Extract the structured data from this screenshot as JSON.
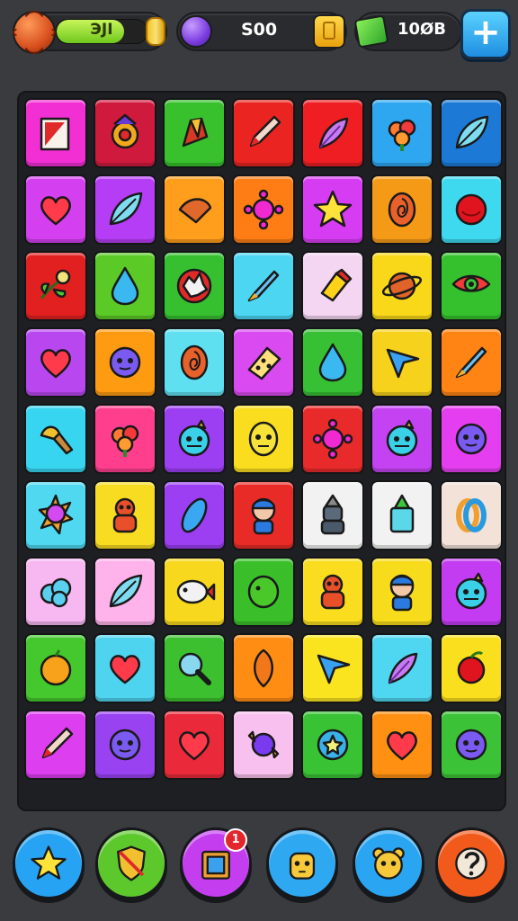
{
  "hud": {
    "level_text": "ЭJI",
    "level_progress": 0.75,
    "gems_text": "S00",
    "cash_text": "10ØB",
    "add_label": "+"
  },
  "board": {
    "rows": [
      [
        {
          "color": "#f22fd3",
          "icon": "book-icon"
        },
        {
          "color": "#cf1a3d",
          "icon": "totem-icon"
        },
        {
          "color": "#38c12c",
          "icon": "crystal-icon"
        },
        {
          "color": "#ea2420",
          "icon": "pencil-icon"
        },
        {
          "color": "#ee1e22",
          "icon": "feather-icon"
        },
        {
          "color": "#2ea6f0",
          "icon": "flower-icon"
        },
        {
          "color": "#1c7ad6",
          "icon": "leaf-icon"
        }
      ],
      [
        {
          "color": "#d43ff0",
          "icon": "heart-icon"
        },
        {
          "color": "#b53df5",
          "icon": "leaf-icon"
        },
        {
          "color": "#ff9d1c",
          "icon": "cone-icon"
        },
        {
          "color": "#ff7d14",
          "icon": "virus-icon"
        },
        {
          "color": "#d63cf2",
          "icon": "star-icon"
        },
        {
          "color": "#f59a16",
          "icon": "swirl-icon"
        },
        {
          "color": "#3ed8ef",
          "icon": "ball-icon"
        }
      ],
      [
        {
          "color": "#e22020",
          "icon": "branch-icon"
        },
        {
          "color": "#5bc926",
          "icon": "drop-icon"
        },
        {
          "color": "#36c030",
          "icon": "burst-icon"
        },
        {
          "color": "#4cd6f2",
          "icon": "rocket-icon"
        },
        {
          "color": "#f4d6f2",
          "icon": "marker-icon"
        },
        {
          "color": "#f9d81a",
          "icon": "planet-icon"
        },
        {
          "color": "#35c12d",
          "icon": "eye-icon"
        }
      ],
      [
        {
          "color": "#b847f0",
          "icon": "heart-icon"
        },
        {
          "color": "#ff9b10",
          "icon": "orb-icon"
        },
        {
          "color": "#5fe0f0",
          "icon": "swirl-icon"
        },
        {
          "color": "#d94bf0",
          "icon": "dice-icon"
        },
        {
          "color": "#38c034",
          "icon": "drop-icon"
        },
        {
          "color": "#f7d21c",
          "icon": "arrow-icon"
        },
        {
          "color": "#ff8413",
          "icon": "rocket-icon"
        }
      ],
      [
        {
          "color": "#38d5f0",
          "icon": "brush-icon"
        },
        {
          "color": "#ff3f8e",
          "icon": "flower-icon"
        },
        {
          "color": "#9c3ef2",
          "icon": "monster-icon"
        },
        {
          "color": "#f9dd1e",
          "icon": "face-icon"
        },
        {
          "color": "#e92a2a",
          "icon": "virus-icon"
        },
        {
          "color": "#c442f2",
          "icon": "monster-icon"
        },
        {
          "color": "#e53ef0",
          "icon": "orb-icon"
        }
      ],
      [
        {
          "color": "#4fd8f0",
          "icon": "sun-icon"
        },
        {
          "color": "#f8dc22",
          "icon": "robot-icon"
        },
        {
          "color": "#9c3ef2",
          "icon": "capsule-icon"
        },
        {
          "color": "#e92b28",
          "icon": "character-icon"
        },
        {
          "color": "#f2f2f2",
          "icon": "knight-icon"
        },
        {
          "color": "#f2f2f2",
          "icon": "potion-icon"
        },
        {
          "color": "#f2e2d8",
          "icon": "knot-icon"
        }
      ],
      [
        {
          "color": "#f7b8f2",
          "icon": "cloud-icon"
        },
        {
          "color": "#ffb3ea",
          "icon": "leaf-icon"
        },
        {
          "color": "#f7d81e",
          "icon": "fish-icon"
        },
        {
          "color": "#3abf2a",
          "icon": "blob-icon"
        },
        {
          "color": "#f9dd1e",
          "icon": "robot-icon"
        },
        {
          "color": "#f7dc1c",
          "icon": "character-icon"
        },
        {
          "color": "#c43cf2",
          "icon": "monster-icon"
        }
      ],
      [
        {
          "color": "#44c82e",
          "icon": "fruit-icon"
        },
        {
          "color": "#4fd4f0",
          "icon": "heart-icon"
        },
        {
          "color": "#3cc030",
          "icon": "magnifier-icon"
        },
        {
          "color": "#ff8d14",
          "icon": "seed-icon"
        },
        {
          "color": "#f9e41f",
          "icon": "arrow-icon"
        },
        {
          "color": "#4fd6f0",
          "icon": "feather-icon"
        },
        {
          "color": "#f9df1e",
          "icon": "apple-icon"
        }
      ],
      [
        {
          "color": "#dc3ef0",
          "icon": "pencil-icon"
        },
        {
          "color": "#9942f2",
          "icon": "orb-icon"
        },
        {
          "color": "#ea2a3a",
          "icon": "heart-icon"
        },
        {
          "color": "#f8c0ee",
          "icon": "candy-icon"
        },
        {
          "color": "#38c234",
          "icon": "star-orb-icon"
        },
        {
          "color": "#ff9012",
          "icon": "heart-icon"
        },
        {
          "color": "#3bc236",
          "icon": "orb-icon"
        }
      ]
    ]
  },
  "bottom_bar": {
    "buttons": [
      {
        "name": "star-button",
        "icon": "star-icon",
        "color": "#26a3f2"
      },
      {
        "name": "shield-button",
        "icon": "shield-icon",
        "color": "#5cc82c"
      },
      {
        "name": "inventory-button",
        "icon": "inventory-icon",
        "color": "#c43ef0",
        "badge": "1"
      },
      {
        "name": "pet-button",
        "icon": "pet-icon",
        "color": "#2fa8f2"
      },
      {
        "name": "bear-button",
        "icon": "bear-icon",
        "color": "#2aa5f2"
      },
      {
        "name": "help-button",
        "icon": "question-icon",
        "color": "#f25a1c"
      }
    ]
  }
}
